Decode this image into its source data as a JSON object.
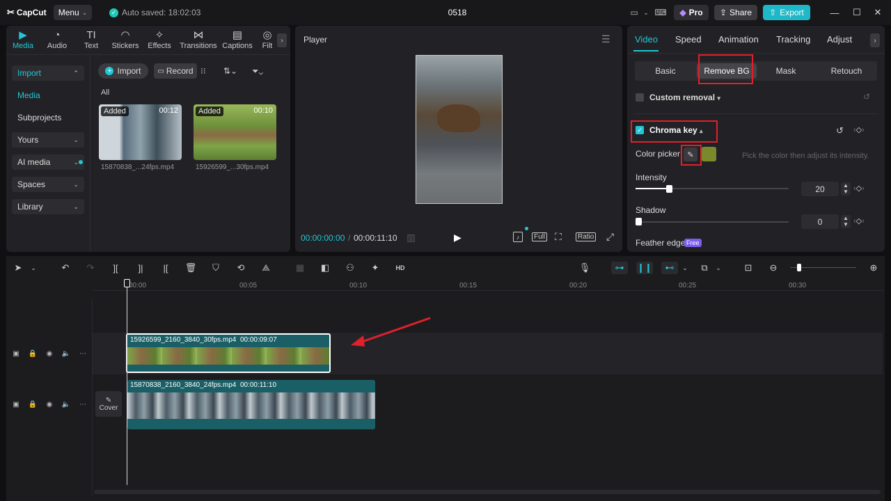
{
  "app": {
    "logo": "CapCut",
    "menu_label": "Menu",
    "autosave": "Auto saved: 18:02:03",
    "project_title": "0518",
    "pro_label": "Pro",
    "share_label": "Share",
    "export_label": "Export"
  },
  "media_tabs": [
    {
      "label": "Media"
    },
    {
      "label": "Audio"
    },
    {
      "label": "Text"
    },
    {
      "label": "Stickers"
    },
    {
      "label": "Effects"
    },
    {
      "label": "Transitions"
    },
    {
      "label": "Captions"
    },
    {
      "label": "Filt"
    }
  ],
  "sidebar": {
    "import": "Import",
    "media": "Media",
    "subprojects": "Subprojects",
    "yours": "Yours",
    "ai_media": "AI media",
    "spaces": "Spaces",
    "library": "Library"
  },
  "media_toolbar": {
    "import_label": "Import",
    "record_label": "Record",
    "filter_all": "All"
  },
  "media_items": [
    {
      "badge": "Added",
      "duration": "00:12",
      "filename": "15870838_...24fps.mp4"
    },
    {
      "badge": "Added",
      "duration": "00:10",
      "filename": "15926599_...30fps.mp4"
    }
  ],
  "player": {
    "title": "Player",
    "current_time": "00:00:00:00",
    "separator": "/",
    "total_time": "00:00:11:10",
    "full_label": "Full",
    "ratio_label": "Ratio"
  },
  "right_panel": {
    "tabs": [
      {
        "label": "Video"
      },
      {
        "label": "Speed"
      },
      {
        "label": "Animation"
      },
      {
        "label": "Tracking"
      },
      {
        "label": "Adjust"
      }
    ],
    "subtabs": [
      {
        "label": "Basic"
      },
      {
        "label": "Remove BG"
      },
      {
        "label": "Mask"
      },
      {
        "label": "Retouch"
      }
    ],
    "custom_removal": "Custom removal",
    "chroma_key": "Chroma key",
    "color_picker": "Color picker",
    "picker_hint": "Pick the color then adjust its intensity.",
    "picked_color": "#7a8a2a",
    "intensity_label": "Intensity",
    "intensity_value": "20",
    "intensity_fraction": 0.2,
    "shadow_label": "Shadow",
    "shadow_value": "0",
    "shadow_fraction": 0,
    "feather_label": "Feather edge",
    "free_badge": "Free"
  },
  "timeline": {
    "ruler": [
      "00:00",
      "00:05",
      "00:10",
      "00:15",
      "00:20",
      "00:25",
      "00:30"
    ],
    "cover_label": "Cover",
    "clip1": {
      "name": "15926599_2160_3840_30fps.mp4",
      "duration": "00:00:09:07"
    },
    "clip2": {
      "name": "15870838_2160_3840_24fps.mp4",
      "duration": "00:00:11:10"
    }
  },
  "colors": {
    "accent": "#22c7d5",
    "highlight": "#e0202b",
    "clip_bg": "#1b5f66"
  }
}
